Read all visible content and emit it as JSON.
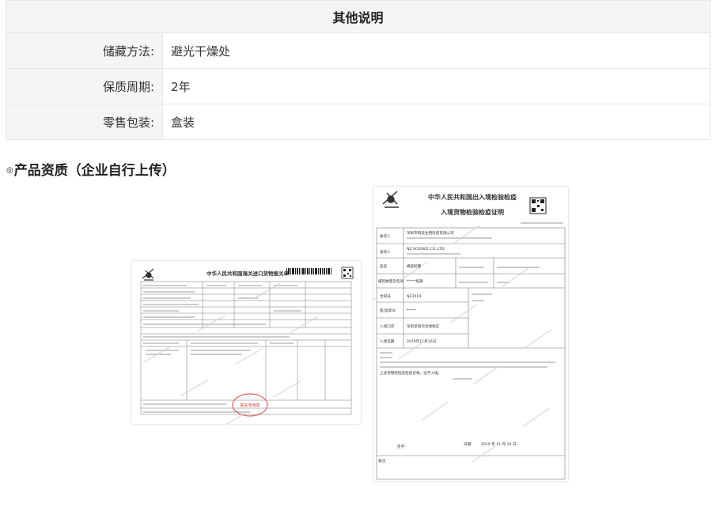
{
  "spec": {
    "header": "其他说明",
    "rows": [
      {
        "label": "储藏方法:",
        "value": "避光干燥处"
      },
      {
        "label": "保质周期:",
        "value": "2年"
      },
      {
        "label": "零售包装:",
        "value": "盒装"
      }
    ]
  },
  "qualification": {
    "mark": "◎",
    "title": "产品资质（企业自行上传）"
  },
  "cert_customs": {
    "title": "中华人民共和国海关进口货物报关单",
    "stamp": "报关专用章"
  },
  "cert_inspect": {
    "title1": "中华人民共和国出入境检验检疫",
    "title2": "入境货物检验检疫证明",
    "rows": [
      {
        "label": "收货人",
        "value": "深圳市特美生物科技有限公司"
      },
      {
        "label": "发货人",
        "value": "NZ SCIENCE CO.,LTD."
      },
      {
        "label": "品名",
        "value": "蜂胶胶囊"
      },
      {
        "label": "报检数量及包装",
        "value": "*****纸箱"
      },
      {
        "label": "合同号",
        "value": "NZ2019"
      },
      {
        "label": "提/运单号",
        "value": "*****"
      },
      {
        "label": "入境口岸",
        "value": "深圳皇岗综合保税区"
      },
      {
        "label": "入境日期",
        "value": "2019年11月10日"
      }
    ],
    "summary": "上述货物经检验检疫合格，准予入境。",
    "sign_label": "签字:",
    "date_label": "日期:",
    "date_value": "2019 年 11 月 10 日",
    "remark_label": "备注"
  },
  "colors": {
    "label_bg": "#f5f5f5",
    "border": "#e6e6e6",
    "stamp": "#d23c3c"
  }
}
